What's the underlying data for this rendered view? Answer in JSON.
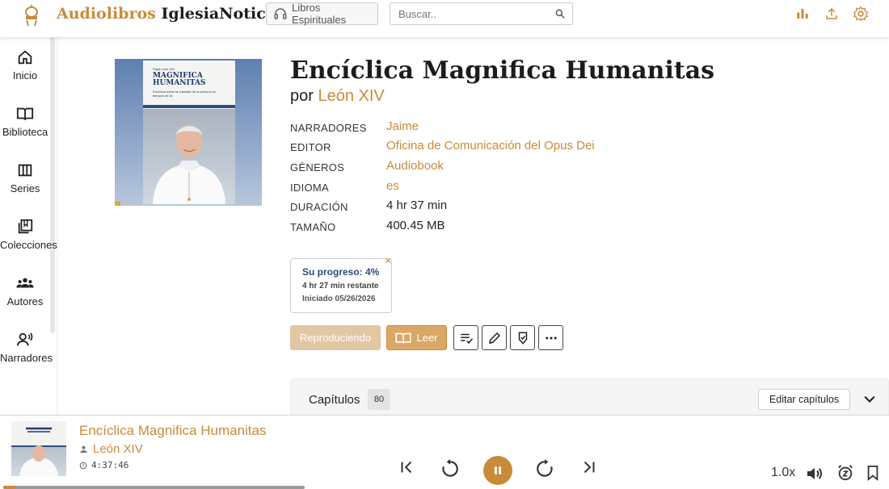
{
  "header": {
    "brand_part1": "Audiolibros",
    "brand_part2": "IglesiaNoticias",
    "library_button": "Libros Espirituales",
    "search_placeholder": "Buscar.."
  },
  "sidebar": {
    "items": [
      {
        "label": "Inicio",
        "icon": "home-icon"
      },
      {
        "label": "Biblioteca",
        "icon": "open-book-icon"
      },
      {
        "label": "Series",
        "icon": "columns-icon"
      },
      {
        "label": "Colecciones",
        "icon": "stacked-books-icon"
      },
      {
        "label": "Autores",
        "icon": "people-icon"
      },
      {
        "label": "Narradores",
        "icon": "speaker-person-icon"
      }
    ]
  },
  "cover": {
    "kicker": "Papa León XIV",
    "title_line1": "MAGNIFICA",
    "title_line2": "HUMANITAS",
    "subtitle": "Encíclica sobre la custodia de la persona en tiempos de IA"
  },
  "book": {
    "title": "Encíclica Magnifica Humanitas",
    "by_prefix": "por",
    "author": "León XIV"
  },
  "details": [
    {
      "key": "NARRADORES",
      "value": "Jaime",
      "link": true
    },
    {
      "key": "EDITOR",
      "value": "Oficina de Comunicación del Opus Dei",
      "link": true
    },
    {
      "key": "GÉNEROS",
      "value": "Audiobook",
      "link": true
    },
    {
      "key": "IDIOMA",
      "value": "es",
      "link": true
    },
    {
      "key": "DURACIÓN",
      "value": "4 hr 37 min",
      "link": false
    },
    {
      "key": "TAMAÑO",
      "value": "400.45 MB",
      "link": false
    }
  ],
  "progress": {
    "title": "Su progreso: 4%",
    "remaining": "4 hr 27 min restante",
    "started": "Iniciado 05/26/2026",
    "percent": 4
  },
  "actions": {
    "playing_label": "Reproduciendo",
    "read_label": "Leer"
  },
  "chapters": {
    "label": "Capítulos",
    "count": "80",
    "edit_label": "Editar capítulos"
  },
  "player": {
    "title": "Encíclica Magnifica Humanitas",
    "author": "León XIV",
    "time": "4:37:46",
    "speed": "1.0x",
    "progress_fraction": 0.04
  },
  "colors": {
    "accent": "#c98b39",
    "progress_text": "#2c4a7c"
  }
}
